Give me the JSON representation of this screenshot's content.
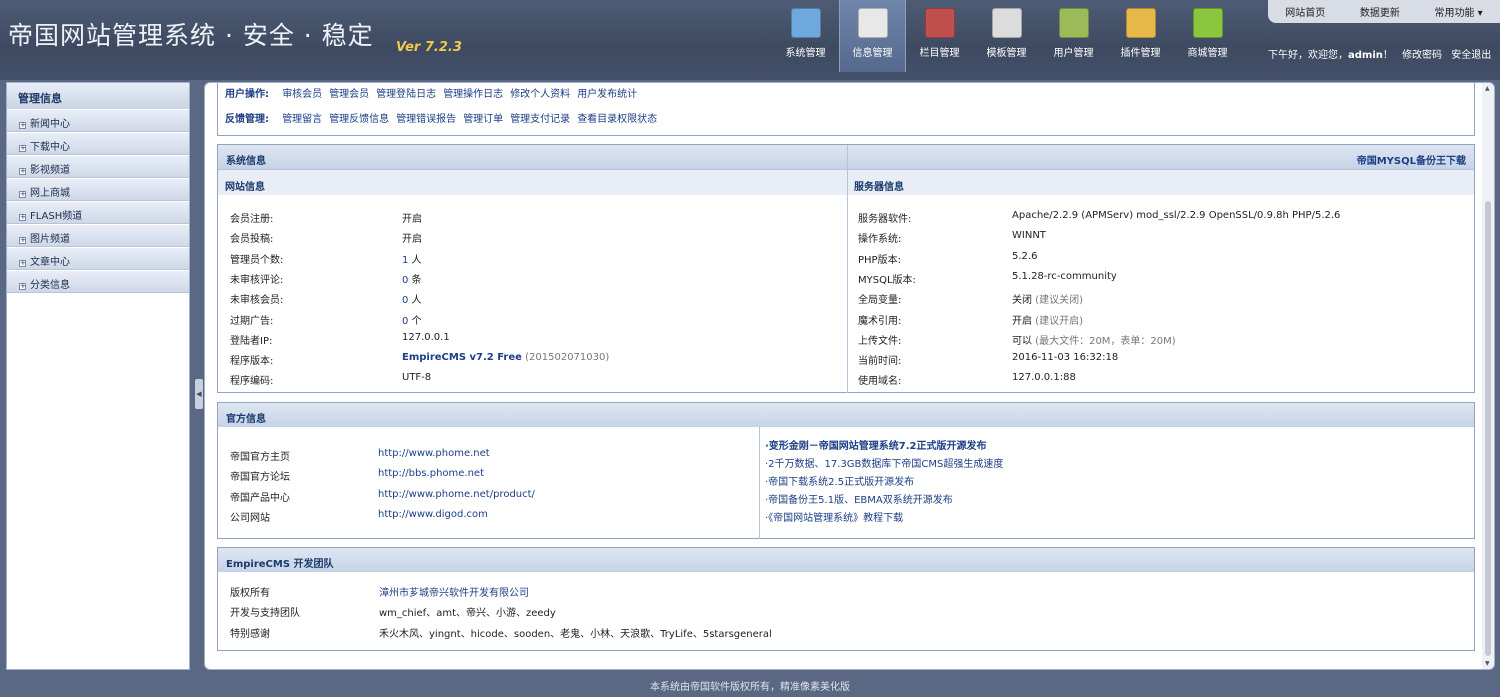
{
  "app": {
    "title": "帝国网站管理系统 · 安全 · 稳定",
    "version": "Ver 7.2.3"
  },
  "topnav": [
    {
      "label": "系统管理",
      "icon": "monitor-icon",
      "color": "#6fa8dc"
    },
    {
      "label": "信息管理",
      "icon": "notepad-icon",
      "color": "#e8e8e8"
    },
    {
      "label": "栏目管理",
      "icon": "book-icon",
      "color": "#c0504d"
    },
    {
      "label": "模板管理",
      "icon": "template-icon",
      "color": "#dcdcdc"
    },
    {
      "label": "用户管理",
      "icon": "cabinet-icon",
      "color": "#9bbb59"
    },
    {
      "label": "插件管理",
      "icon": "box-icon",
      "color": "#e6b84a"
    },
    {
      "label": "商城管理",
      "icon": "shopping-bag-icon",
      "color": "#8cc63f"
    }
  ],
  "toplinks": {
    "home": "网站首页",
    "update": "数据更新",
    "common": "常用功能"
  },
  "welcome": {
    "greeting": "下午好，欢迎您，",
    "user": "admin",
    "suffix": "！",
    "change_pw": "修改密码",
    "logout": "安全退出"
  },
  "sidebar": {
    "title": "管理信息",
    "items": [
      "新闻中心",
      "下载中心",
      "影视频道",
      "网上商城",
      "FLASH频道",
      "图片频道",
      "文章中心",
      "分类信息"
    ]
  },
  "ops": {
    "user_label": "用户操作:",
    "user_links": [
      "审核会员",
      "管理会员",
      "管理登陆日志",
      "管理操作日志",
      "修改个人资料",
      "用户发布统计"
    ],
    "feedback_label": "反馈管理:",
    "feedback_links": [
      "管理留言",
      "管理反馈信息",
      "管理错误报告",
      "管理订单",
      "管理支付记录",
      "查看目录权限状态"
    ]
  },
  "sysinfo": {
    "title": "系统信息",
    "backup_link": "帝国MYSQL备份王下载",
    "site_title": "网站信息",
    "server_title": "服务器信息",
    "site": [
      {
        "k": "会员注册:",
        "v": "开启"
      },
      {
        "k": "会员投稿:",
        "v": "开启"
      },
      {
        "k": "管理员个数:",
        "v": "1",
        "u": " 人"
      },
      {
        "k": "未审核评论:",
        "v": "0",
        "u": " 条"
      },
      {
        "k": "未审核会员:",
        "v": "0",
        "u": " 人"
      },
      {
        "k": "过期广告:",
        "v": "0",
        "u": " 个"
      },
      {
        "k": "登陆者IP:",
        "v": "127.0.0.1"
      },
      {
        "k": "程序版本:",
        "v": "EmpireCMS v7.2 Free",
        "u": " (201502071030)"
      },
      {
        "k": "程序编码:",
        "v": "UTF-8"
      }
    ],
    "server": [
      {
        "k": "服务器软件:",
        "v": "Apache/2.2.9 (APMServ) mod_ssl/2.2.9 OpenSSL/0.9.8h PHP/5.2.6"
      },
      {
        "k": "操作系统:",
        "v": "WINNT"
      },
      {
        "k": "PHP版本:",
        "v": "5.2.6"
      },
      {
        "k": "MYSQL版本:",
        "v": "5.1.28-rc-community"
      },
      {
        "k": "全局变量:",
        "v": "关闭",
        "u": " (建议关闭)"
      },
      {
        "k": "魔术引用:",
        "v": "开启",
        "u": " (建议开启)"
      },
      {
        "k": "上传文件:",
        "v": "可以",
        "u": " (最大文件：20M，表单：20M)"
      },
      {
        "k": "当前时间:",
        "v": "2016-11-03 16:32:18"
      },
      {
        "k": "使用域名:",
        "v": "127.0.0.1:88"
      }
    ]
  },
  "official": {
    "title": "官方信息",
    "links": [
      {
        "k": "帝国官方主页",
        "v": "http://www.phome.net"
      },
      {
        "k": "帝国官方论坛",
        "v": "http://bbs.phome.net"
      },
      {
        "k": "帝国产品中心",
        "v": "http://www.phome.net/product/"
      },
      {
        "k": "公司网站",
        "v": "http://www.digod.com"
      }
    ],
    "news": [
      "·变形金刚－帝国网站管理系统7.2正式版开源发布",
      "·2千万数据、17.3GB数据库下帝国CMS超强生成速度",
      "·帝国下载系统2.5正式版开源发布",
      "·帝国备份王5.1版、EBMA双系统开源发布",
      "·《帝国网站管理系统》教程下载"
    ]
  },
  "team": {
    "title": "EmpireCMS 开发团队",
    "rows": [
      {
        "k": "版权所有",
        "v": "漳州市芗城帝兴软件开发有限公司"
      },
      {
        "k": "开发与支持团队",
        "v": "wm_chief、amt、帝兴、小游、zeedy"
      },
      {
        "k": "特别感谢",
        "v": "禾火木风、yingnt、hicode、sooden、老鬼、小林、天浪歌、TryLife、5starsgeneral"
      }
    ]
  },
  "footer": "本系统由帝国软件版权所有，精准像素美化版"
}
